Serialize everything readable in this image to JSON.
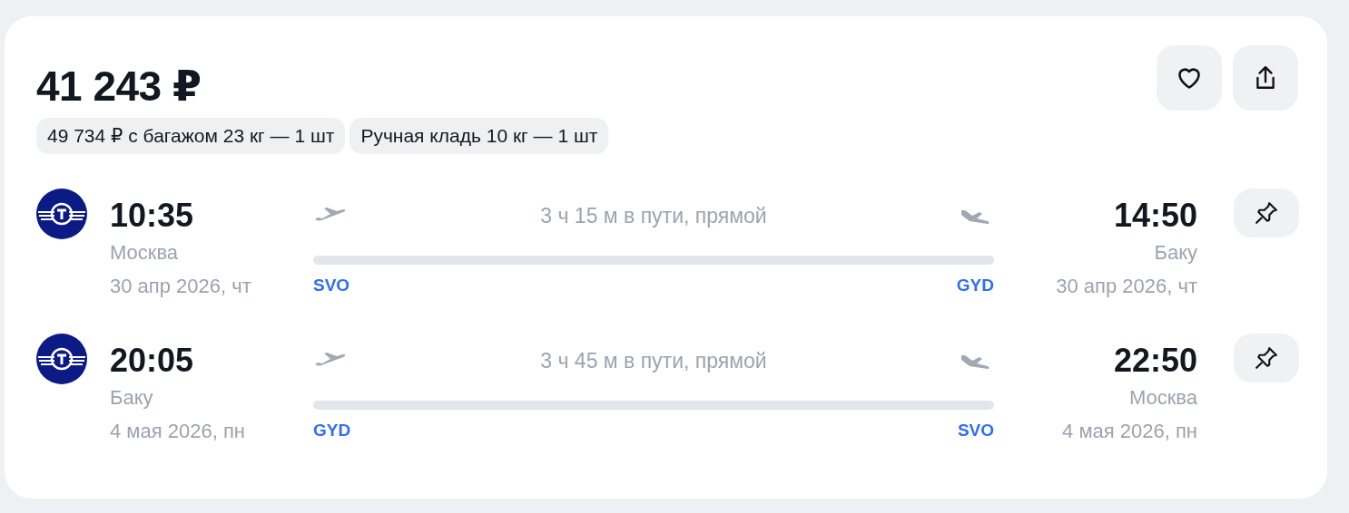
{
  "price": "41 243 ₽",
  "actions": [
    {
      "kind": "favorite"
    },
    {
      "kind": "share"
    }
  ],
  "chips": [
    "49 734 ₽ с багажом 23 кг — 1 шт",
    "Ручная кладь 10 кг — 1 шт"
  ],
  "segments": [
    {
      "depart": {
        "time": "10:35",
        "city": "Москва",
        "date": "30 апр 2026, чт",
        "code": "SVO"
      },
      "duration": "3 ч 15 м в пути, прямой",
      "arrive": {
        "time": "14:50",
        "city": "Баку",
        "date": "30 апр 2026, чт",
        "code": "GYD"
      }
    },
    {
      "depart": {
        "time": "20:05",
        "city": "Баку",
        "date": "4 мая 2026, пн",
        "code": "GYD"
      },
      "duration": "3 ч 45 м в пути, прямой",
      "arrive": {
        "time": "22:50",
        "city": "Москва",
        "date": "4 мая 2026, пн",
        "code": "SVO"
      }
    }
  ]
}
